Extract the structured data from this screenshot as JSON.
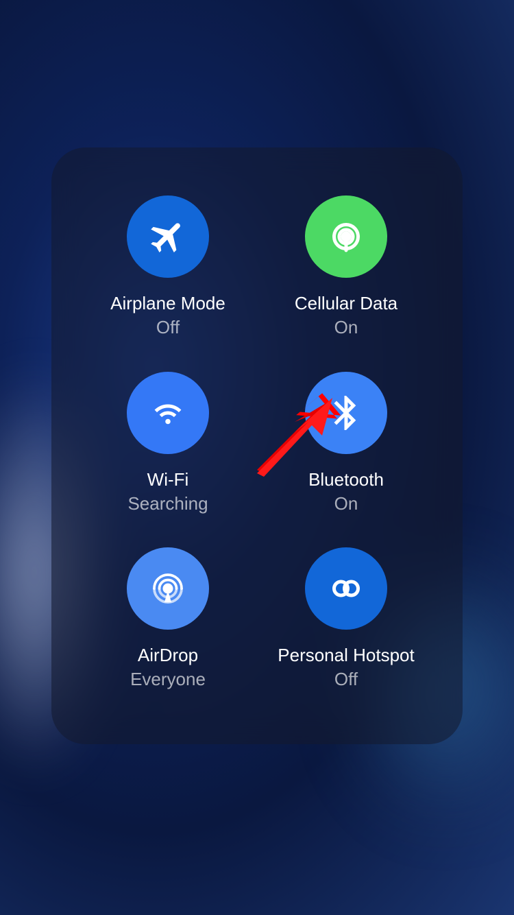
{
  "panel": {
    "airplane": {
      "label": "Airplane Mode",
      "status": "Off"
    },
    "cellular": {
      "label": "Cellular Data",
      "status": "On"
    },
    "wifi": {
      "label": "Wi-Fi",
      "status": "Searching"
    },
    "bluetooth": {
      "label": "Bluetooth",
      "status": "On"
    },
    "airdrop": {
      "label": "AirDrop",
      "status": "Everyone"
    },
    "hotspot": {
      "label": "Personal Hotspot",
      "status": "Off"
    }
  },
  "colors": {
    "blue_inactive": "#1267d8",
    "green_active": "#4cd964",
    "blue_active": "#3478f6"
  }
}
